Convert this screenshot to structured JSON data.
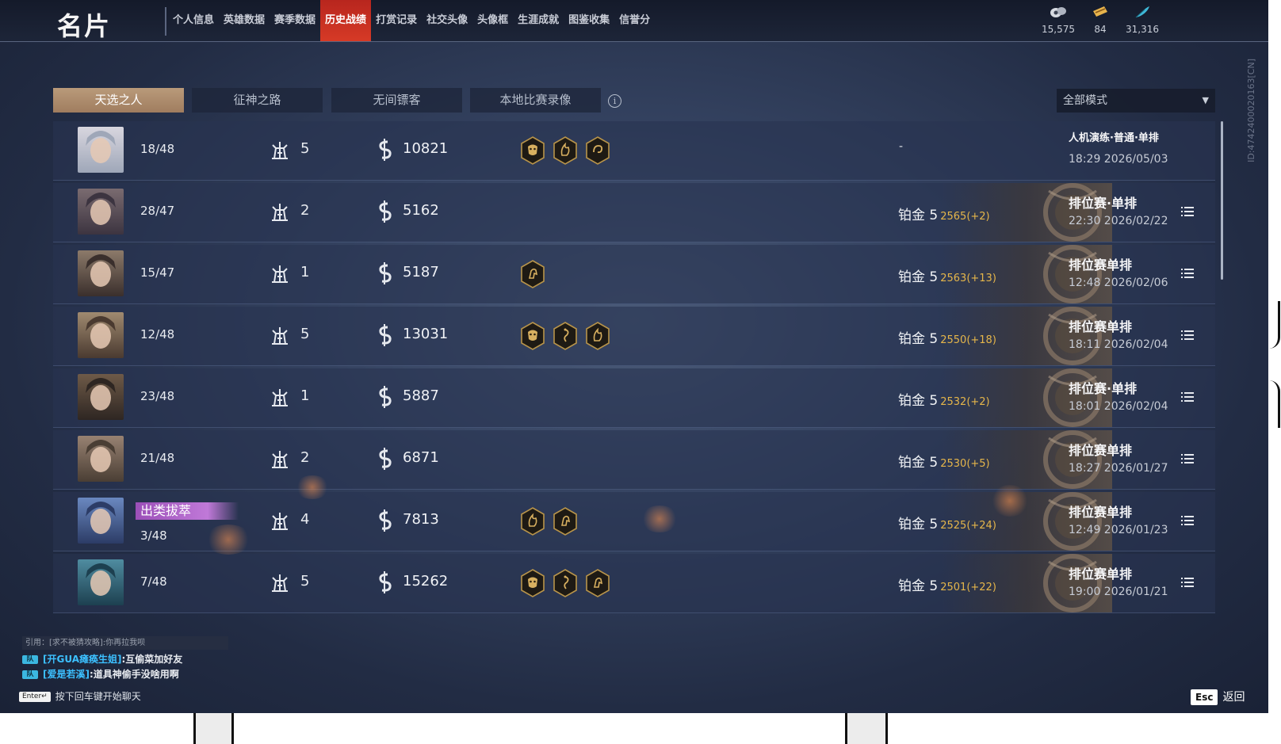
{
  "header": {
    "title": "名片",
    "nav": [
      "个人信息",
      "英雄数据",
      "赛季数据",
      "历史战绩",
      "打赏记录",
      "社交头像",
      "头像框",
      "生涯成就",
      "图鉴收集",
      "信誉分"
    ],
    "active_nav": "历史战绩",
    "currencies": [
      {
        "icon": "coin-bag-icon",
        "value": "15,575"
      },
      {
        "icon": "ticket-icon",
        "value": "84"
      },
      {
        "icon": "feather-icon",
        "value": "31,316"
      }
    ]
  },
  "player_id": "ID:4742400020163[CN]",
  "tabs": [
    "天选之人",
    "征神之路",
    "无间镖客",
    "本地比赛录像"
  ],
  "active_tab": "天选之人",
  "mode_filter": {
    "label": "全部模式"
  },
  "matches": [
    {
      "kd": "18/48",
      "towers": "5",
      "coins": "10821",
      "medals": [
        "demon-mask-medal-icon",
        "flame-medal-icon",
        "swirl-medal-icon"
      ],
      "rank": "-",
      "rank_points": "",
      "mode": "人机演练·普通·单排",
      "time": "18:29 2026/05/03",
      "has_menu": false,
      "tag": ""
    },
    {
      "kd": "28/47",
      "towers": "2",
      "coins": "5162",
      "medals": [],
      "rank": "铂金 5",
      "rank_points": "2565(+2)",
      "mode": "排位赛·单排",
      "time": "22:30 2026/02/22",
      "has_menu": true,
      "tag": ""
    },
    {
      "kd": "15/47",
      "towers": "1",
      "coins": "5187",
      "medals": [
        "horse-medal-icon"
      ],
      "rank": "铂金 5",
      "rank_points": "2563(+13)",
      "mode": "排位赛单排",
      "time": "12:48 2026/02/06",
      "has_menu": true,
      "tag": ""
    },
    {
      "kd": "12/48",
      "towers": "5",
      "coins": "13031",
      "medals": [
        "demon-mask-medal-icon",
        "dragon-medal-icon",
        "flame-medal-icon"
      ],
      "rank": "铂金 5",
      "rank_points": "2550(+18)",
      "mode": "排位赛单排",
      "time": "18:11 2026/02/04",
      "has_menu": true,
      "tag": ""
    },
    {
      "kd": "23/48",
      "towers": "1",
      "coins": "5887",
      "medals": [],
      "rank": "铂金 5",
      "rank_points": "2532(+2)",
      "mode": "排位赛·单排",
      "time": "18:01 2026/02/04",
      "has_menu": true,
      "tag": ""
    },
    {
      "kd": "21/48",
      "towers": "2",
      "coins": "6871",
      "medals": [],
      "rank": "铂金 5",
      "rank_points": "2530(+5)",
      "mode": "排位赛单排",
      "time": "18:27 2026/01/27",
      "has_menu": true,
      "tag": ""
    },
    {
      "kd": "3/48",
      "towers": "4",
      "coins": "7813",
      "medals": [
        "flame-medal-icon",
        "horse-medal-icon"
      ],
      "rank": "铂金 5",
      "rank_points": "2525(+24)",
      "mode": "排位赛单排",
      "time": "12:49 2026/01/23",
      "has_menu": true,
      "tag": "出类拔萃"
    },
    {
      "kd": "7/48",
      "towers": "5",
      "coins": "15262",
      "medals": [
        "demon-mask-medal-icon",
        "dragon-medal-icon",
        "horse-medal-icon"
      ],
      "rank": "铂金 5",
      "rank_points": "2501(+22)",
      "mode": "排位赛单排",
      "time": "19:00 2026/01/21",
      "has_menu": true,
      "tag": ""
    }
  ],
  "chat": {
    "quote": "引用：[求不被猜攻略]:你再拉我呗",
    "messages": [
      {
        "channel": "队",
        "user": "[开GUA瘫痪生姐]",
        "text": ":互偷菜加好友"
      },
      {
        "channel": "队",
        "user": "[爱是若溪]",
        "text": ":道具神偷手没啥用啊"
      }
    ],
    "enter_key": "Enter↵",
    "hint": "按下回车键开始聊天"
  },
  "footer": {
    "esc_key": "Esc",
    "back_label": "返回"
  }
}
